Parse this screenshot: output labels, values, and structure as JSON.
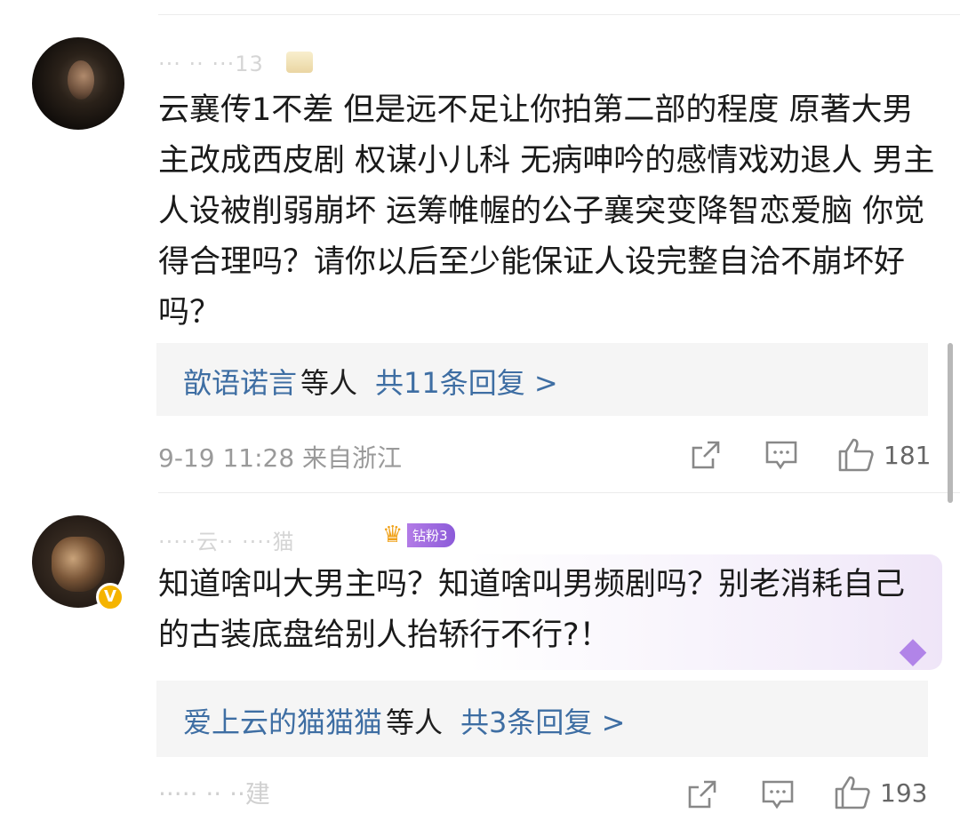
{
  "comments": [
    {
      "username": "··· ·· ···13",
      "text": "云襄传1不差 但是远不足让你拍第二部的程度 原著大男主改成西皮剧 权谋小儿科 无病呻吟的感情戏劝退人 男主人设被削弱崩坏 运筹帷幄的公子襄突变降智恋爱脑 你觉得合理吗？请你以后至少能保证人设完整自洽不崩坏好吗？",
      "replies": {
        "who": "歆语诺言",
        "suffix": "等人",
        "count": "共11条回复 >"
      },
      "meta": "9-19 11:28 来自浙江",
      "likes": "181"
    },
    {
      "username": "·····云·· ····猫",
      "fan_badge": "钻粉3",
      "text": "知道啥叫大男主吗？知道啥叫男频剧吗？别老消耗自己的古装底盘给别人抬轿行不行?！",
      "replies": {
        "who": "爱上云的猫猫猫",
        "suffix": "等人",
        "count": "共3条回复 >"
      },
      "meta": "····· ·· ··建",
      "likes": "193"
    }
  ],
  "icons": {
    "share": "share-icon",
    "comment": "comment-icon",
    "like": "like-icon",
    "verified": "verified-v-badge"
  },
  "colors": {
    "link": "#3e6ea3",
    "reply_bg": "#f5f5f5",
    "verified": "#f5b400",
    "fan_badge": "#a06ee0"
  }
}
